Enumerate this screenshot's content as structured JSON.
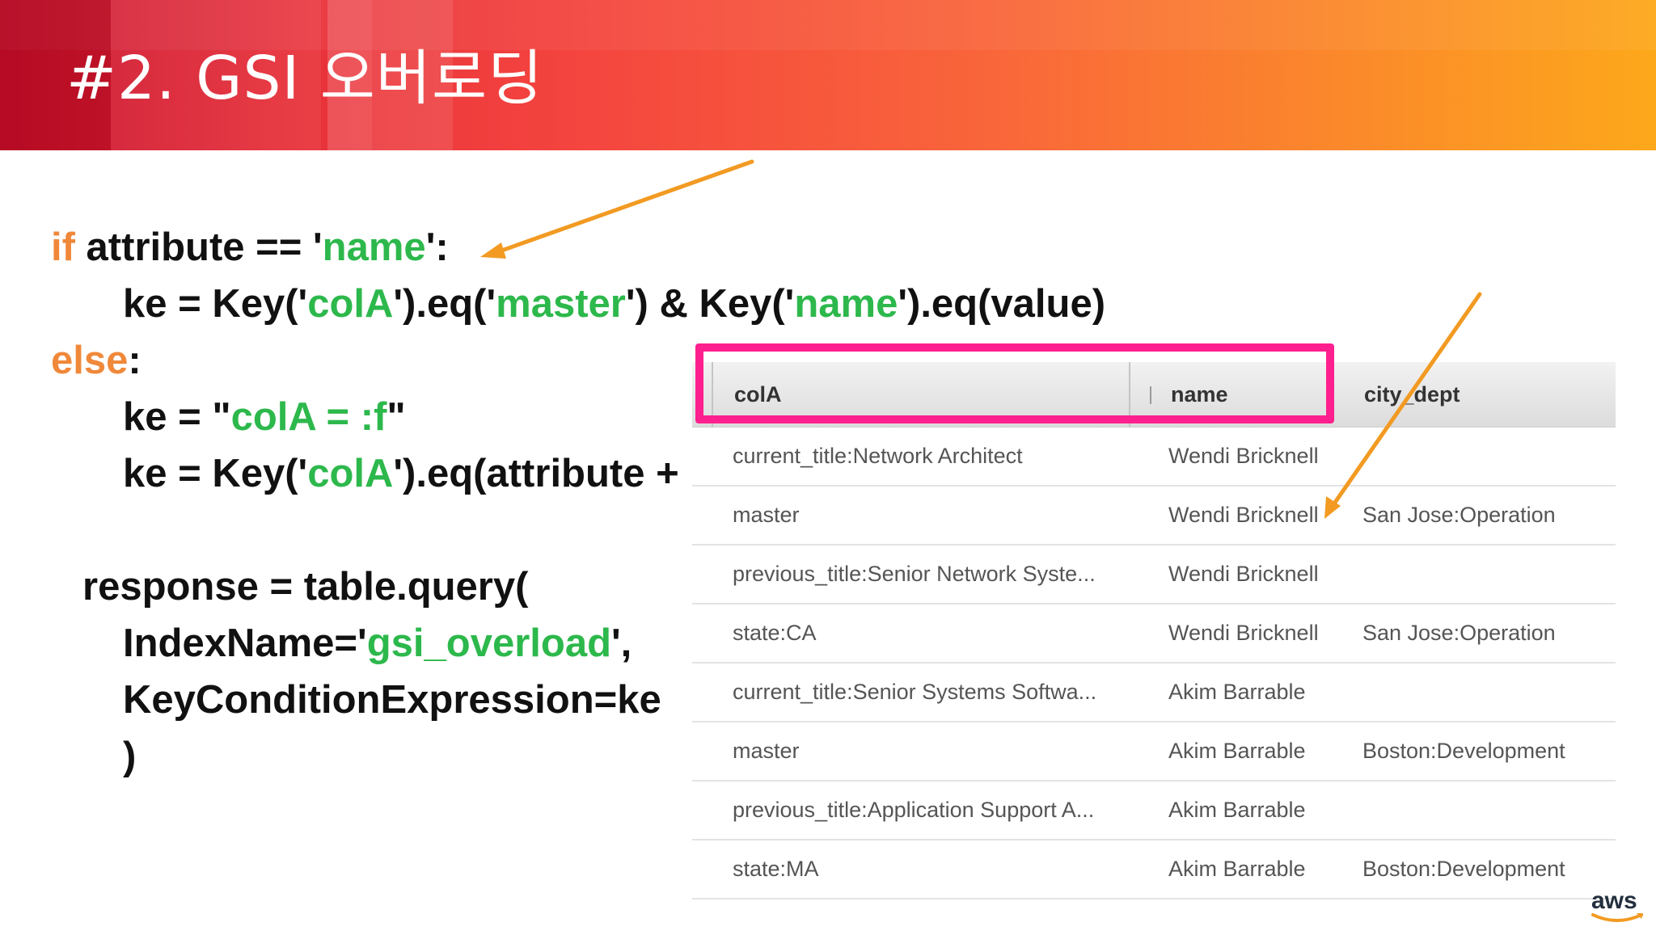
{
  "slide": {
    "title": "#2. GSI 오버로딩"
  },
  "code": {
    "line1": {
      "kw": "if",
      "t1": " attribute == '",
      "s1": "name",
      "t2": "':"
    },
    "line2": {
      "t1": "ke = Key('",
      "s1": "colA",
      "t2": "').eq('",
      "s2": "master",
      "t3": "') & Key('",
      "s3": "name",
      "t4": "').eq(value)"
    },
    "line3": {
      "kw": "else",
      "t1": ":"
    },
    "line4": {
      "t1": "ke = \"",
      "s1": "colA = :f",
      "t2": "\""
    },
    "line5": {
      "t1": "ke = Key('",
      "s1": "colA",
      "t2": "').eq(attribute +"
    },
    "line6": {
      "t1": "response = table.query("
    },
    "line7": {
      "t1": "IndexName='",
      "s1": "gsi_overload",
      "t2": "',"
    },
    "line8": {
      "t1": "KeyConditionExpression=ke"
    },
    "line9": {
      "t1": ")"
    }
  },
  "table": {
    "columns": [
      "colA",
      "name",
      "city_dept"
    ],
    "rows": [
      [
        "current_title:Network Architect",
        "Wendi Bricknell",
        ""
      ],
      [
        "master",
        "Wendi Bricknell",
        "San Jose:Operation"
      ],
      [
        "previous_title:Senior Network Syste...",
        "Wendi Bricknell",
        ""
      ],
      [
        "state:CA",
        "Wendi Bricknell",
        "San Jose:Operation"
      ],
      [
        "current_title:Senior Systems Softwa...",
        "Akim Barrable",
        ""
      ],
      [
        "master",
        "Akim Barrable",
        "Boston:Development"
      ],
      [
        "previous_title:Application Support A...",
        "Akim Barrable",
        ""
      ],
      [
        "state:MA",
        "Akim Barrable",
        "Boston:Development"
      ]
    ]
  },
  "logo": {
    "text": "aws"
  },
  "colors": {
    "keyword": "#f0883a",
    "string": "#2db84c",
    "highlight": "#ff1f8e",
    "arrow": "#f29a22"
  }
}
